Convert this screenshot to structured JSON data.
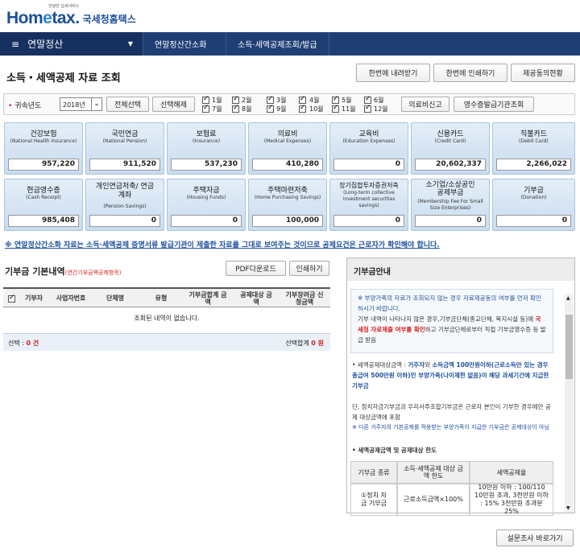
{
  "header": {
    "logo_text_1": "Hom",
    "logo_text_e": "e",
    "logo_text_2": "tax.",
    "logo_sub": "안녕한 납세서비스",
    "logo_kr": "국세청홈택스"
  },
  "nav": {
    "menu": "연말정산",
    "crumbs": [
      "연말정산간소화",
      "소득·세액공제조회/발급"
    ]
  },
  "page_title": "소득・세액공제 자료 조회",
  "top_buttons": [
    "한번에 내려받기",
    "한번에 인쇄하기",
    "제공동의현황"
  ],
  "filter": {
    "year_label": "귀속년도",
    "year_value": "2018년",
    "select_all": "전체선택",
    "deselect_all": "선택해제",
    "months": [
      "1월",
      "2월",
      "3월",
      "4월",
      "5월",
      "6월",
      "7월",
      "8월",
      "9월",
      "10월",
      "11월",
      "12월"
    ],
    "report_btn": "의료비신고",
    "receipt_btn": "영수증발급기관조회"
  },
  "categories": [
    {
      "ko": "건강보험",
      "en": "(National Health Insurance)",
      "value": "957,220"
    },
    {
      "ko": "국민연금",
      "en": "(National Pension)",
      "value": "911,520"
    },
    {
      "ko": "보험료",
      "en": "(Insurance)",
      "value": "537,230"
    },
    {
      "ko": "의료비",
      "en": "(Medical Expenses)",
      "value": "410,280"
    },
    {
      "ko": "교육비",
      "en": "(Education Expenses)",
      "value": "0"
    },
    {
      "ko": "신용카드",
      "en": "(Credit Card)",
      "value": "20,602,337"
    },
    {
      "ko": "직불카드",
      "en": "(Debit Card)",
      "value": "2,266,022"
    },
    {
      "ko": "현금영수증",
      "en": "(Cash Receipt)",
      "value": "985,408"
    },
    {
      "ko": "개인연금저축/ 연금계좌",
      "en": "(Pension Savings)",
      "value": "0"
    },
    {
      "ko": "주택자금",
      "en": "(Housing Funds)",
      "value": "0"
    },
    {
      "ko": "주택마련저축",
      "en": "(Home Purchasing Savings)",
      "value": "100,000"
    },
    {
      "ko": "장기집합투자증권저축",
      "en": "(Long-term collective investment securities savings)",
      "value": "0"
    },
    {
      "ko": "소기업/소상공인 공제부금",
      "en": "(Membership Fee For Small Size Enterprises)",
      "value": "0"
    },
    {
      "ko": "기부금",
      "en": "(Donation)",
      "value": "0"
    }
  ],
  "notice": "※ 연말정산간소화 자료는 소득·세액공제 증명서류 발급기관이 제출한 자료를 그대로 보여주는 것이므로 공제요건은 근로자가 확인해야 합니다.",
  "left": {
    "title": "기부금 기본내역",
    "title_note": "(연간기부금액공제항목)",
    "pdf_btn": "PDF다운로드",
    "print_btn": "인쇄하기",
    "columns": [
      "기부자",
      "사업자번호",
      "단체명",
      "유형",
      "기부금합계 금액",
      "공제대상 금액",
      "기부장려금 신청금액"
    ],
    "empty": "조회된 내역이 없습니다.",
    "selected_label": "선택 :",
    "selected_value": "0 건",
    "sum_label": "선택합계",
    "sum_value": "0 원"
  },
  "right": {
    "title": "기부금안내",
    "info_1": "※ 부양가족의 자료가 조회되지 않는 경우 자료제공동의 여부를 먼저 확인하시기 바랍니다.",
    "info_2a": "기부 내역이 나타나지 않은 경우,기부금단체(종교단체, 복지시설 등)에",
    "info_2b": "국세청 자료제출 여부를 확인",
    "info_2c": "하고 기부금단체로부터 직접 기부금영수증 등 발급 받음",
    "bullet_a": "• 세액공제대상금액 :",
    "bullet_b": "거주자",
    "bullet_c": "와",
    "bullet_d": "소득금액 100만원이하(근로소득만 있는 경우 총급여 500만원 이하)인 부양가족(나이제한 없음)이 해당 과세기간에 지급한 기부금",
    "bullet_e": "단, 정치자금기부금과 우리사주조합기부금은 근로자 본인이 기부한 경우에만 공제 대상금액에 포함",
    "note": "※ 다른 거주자의 기본공제를 적용받는 부양가족이 지급한 기부금은 공제대상이 아님",
    "section": "• 세액공제금액 및 공제대상 한도",
    "table_headers": [
      "기부금 종류",
      "소득·세액공제 대상 금액 한도",
      "세액공제율"
    ],
    "row1_c1": "①정치 자금 기부금",
    "row1_c2": "근로소득금액×100%",
    "row1_c3": "10만원 이하 : 100/110 10만원 초과, 3천만원 이하 : 15% 3천만원 초과분 25%"
  },
  "survey_btn": "설문조사 바로가기"
}
